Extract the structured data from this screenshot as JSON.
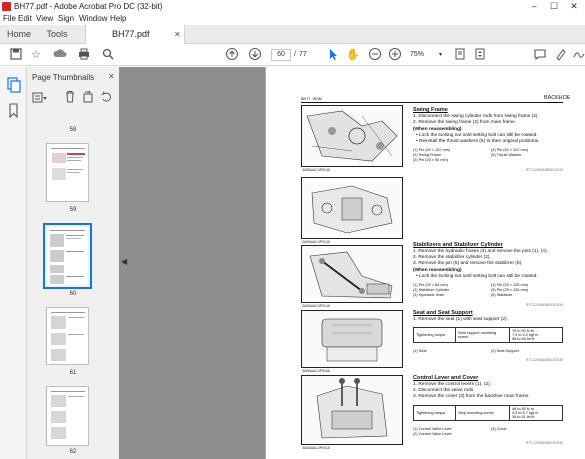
{
  "window": {
    "title": "BH77.pdf - Adobe Acrobat Pro DC (32-bit)"
  },
  "menu": [
    "File",
    "Edit",
    "View",
    "Sign",
    "Window",
    "Help"
  ],
  "tabs": {
    "home": "Home",
    "tools": "Tools",
    "doc": "BH77.pdf"
  },
  "toolbar": {
    "page_current": "60",
    "page_sep": "/",
    "page_total": "77",
    "zoom": "75%"
  },
  "panel": {
    "title": "Page Thumbnails",
    "thumbs": [
      {
        "label": "58"
      },
      {
        "label": "59"
      },
      {
        "label": "60"
      },
      {
        "label": "61"
      },
      {
        "label": "62"
      }
    ]
  },
  "doc": {
    "header_left": "BH77, WSM",
    "header_right": "BACKHOE",
    "swing": {
      "title": "Swing Frame",
      "steps": [
        "1.  Disconnect the swing cylinder rods from swing frame (2).",
        "2.  Remove the swing frame (2) from main frame."
      ],
      "when": "(When reassembling)",
      "notes": [
        "•  Lock the locking nut until setting bolt can still be rotated.",
        "•  Reinstall the thrust washers (5) to their original positions."
      ],
      "legend": [
        [
          "(1)  Pin (40 × 102 mm)",
          "(4)  Pin (40 × 102 mm)"
        ],
        [
          "(2)  Swing Frame",
          "(5)  Thrust Washer"
        ],
        [
          "(3)  Pin (25 × 55 mm)",
          ""
        ]
      ],
      "code": "RTC1205484882010033",
      "fig1": "3UBAAAC4P013A",
      "fig2": "3UBAAAC4P012A"
    },
    "stabilizer": {
      "title": "Stabilizers and Stabilizer Cylinder",
      "steps": [
        "1.  Remove the hydraulic hoses (3) and remove the pins (1), (4).",
        "2.  Remove the stabilizer cylinder (2).",
        "3.  Remove the pin (5) and remove the stabilizer (6)."
      ],
      "when": "(When reassembling)",
      "notes": [
        "•  Lock the locking nut until setting bolt can still be rotated."
      ],
      "legend": [
        [
          "(1)  Pin (25 × 84 mm)",
          "(4)  Pin (25 × 126 mm)"
        ],
        [
          "(2)  Stabilizer Cylinder",
          "(5)  Pin (25 × 126 mm)"
        ],
        [
          "(3)  Hydraulic Hose",
          "(6)  Stabilizer"
        ]
      ],
      "code": "RTC1205484882010034",
      "fig": "3UBAAAC4P014A"
    },
    "seat": {
      "title": "Seat and Seat Support",
      "steps": [
        "1.  Remove the seat (1) with seat support (2)."
      ],
      "torque_label": "Tightening torque",
      "torque_item": "Seat support mounting screw",
      "torque_values": [
        "78 to 90 N·m",
        "7.9 to 9.2 kgf·m",
        "58 to 66 lbf·ft"
      ],
      "legend": [
        [
          "(1)  Seat",
          "(2)  Seat Support"
        ]
      ],
      "code": "RTC1205484882010035",
      "fig": "3UBAAAC4P016A"
    },
    "control": {
      "title": "Control Lever and Cover",
      "steps": [
        "1.  Remove the control levers (1), (2).",
        "2.  Disconnect the valve rods.",
        "3.  Remove the cover (3) from the backhoe main frame."
      ],
      "torque_label": "Tightening torque",
      "torque_item": "Step mounting screw",
      "torque_values": [
        "48 to 55 N·m",
        "4.9 to 5.7 kgf·m",
        "36 to 41 lbf·ft"
      ],
      "legend": [
        [
          "(1)  Control Valve Lever",
          "(3)  Cover"
        ],
        [
          "(2)  Control Valve Lever",
          ""
        ]
      ],
      "code": "RTC1205484882010036",
      "fig": "3UBAAAC4P041A"
    }
  },
  "colors": {
    "accent": "#1473e6",
    "acrobat_red": "#d9261c",
    "gutter": "#8e8e8e"
  }
}
